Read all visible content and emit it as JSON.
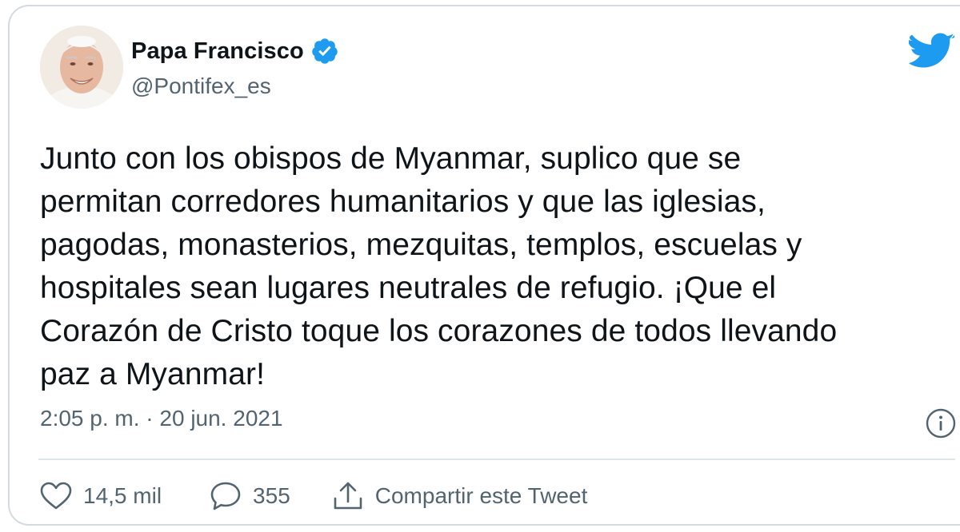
{
  "tweet": {
    "author": {
      "display_name": "Papa Francisco",
      "handle": "@Pontifex_es",
      "verified": true
    },
    "text_lines": [
      "Junto con los obispos de Myanmar, suplico que se",
      "permitan corredores humanitarios y que las iglesias,",
      "pagodas, monasterios, mezquitas, templos, escuelas y",
      "hospitales sean lugares neutrales de refugio. ¡Que el",
      "Corazón de Cristo toque los corazones de todos llevando",
      "paz a Myanmar!"
    ],
    "timestamp": "2:05 p. m. · 20 jun. 2021",
    "actions": {
      "likes": "14,5 mil",
      "replies": "355",
      "share_label": "Compartir este Tweet"
    }
  },
  "icons": {
    "brand": "twitter-bird-icon",
    "verified": "verified-badge-icon",
    "info": "info-icon",
    "like": "heart-icon",
    "reply": "speech-bubble-icon",
    "share": "share-upload-icon"
  },
  "colors": {
    "brand_blue": "#1d9bf0",
    "text_primary": "#0f1419",
    "text_secondary": "#536471",
    "border": "#d3dbe1"
  }
}
